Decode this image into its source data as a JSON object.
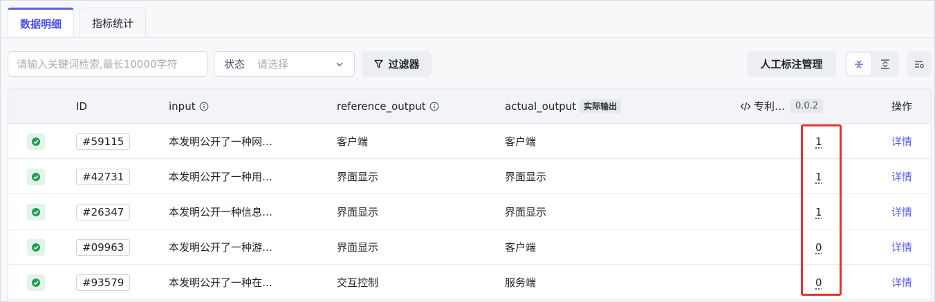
{
  "tabs": [
    {
      "label": "数据明细",
      "active": true
    },
    {
      "label": "指标统计",
      "active": false
    }
  ],
  "toolbar": {
    "search_placeholder": "请输入关键词检索,最长10000字符",
    "status_label": "状态",
    "status_placeholder": "请选择",
    "filter_label": "过滤器",
    "manage_label": "人工标注管理"
  },
  "table": {
    "columns": {
      "id": "ID",
      "input": "input",
      "reference_output": "reference_output",
      "actual_output": "actual_output",
      "actual_output_tag": "实际输出",
      "evaluator": "专利…",
      "evaluator_version": "0.0.2",
      "actions": "操作"
    },
    "rows": [
      {
        "id": "#59115",
        "input": "本发明公开了一种网…",
        "reference_output": "客户端",
        "actual_output": "客户端",
        "score": "1",
        "action": "详情"
      },
      {
        "id": "#42731",
        "input": "本发明公开了一种用…",
        "reference_output": "界面显示",
        "actual_output": "界面显示",
        "score": "1",
        "action": "详情"
      },
      {
        "id": "#26347",
        "input": "本发明公开一种信息…",
        "reference_output": "界面显示",
        "actual_output": "界面显示",
        "score": "1",
        "action": "详情"
      },
      {
        "id": "#09963",
        "input": "本发明公开了一种游…",
        "reference_output": "界面显示",
        "actual_output": "客户端",
        "score": "0",
        "action": "详情"
      },
      {
        "id": "#93579",
        "input": "本发明公开了一种在…",
        "reference_output": "交互控制",
        "actual_output": "服务端",
        "score": "0",
        "action": "详情"
      }
    ]
  },
  "colors": {
    "accent": "#5b5ce6",
    "success": "#1e9e57",
    "highlight": "#e0342f"
  }
}
